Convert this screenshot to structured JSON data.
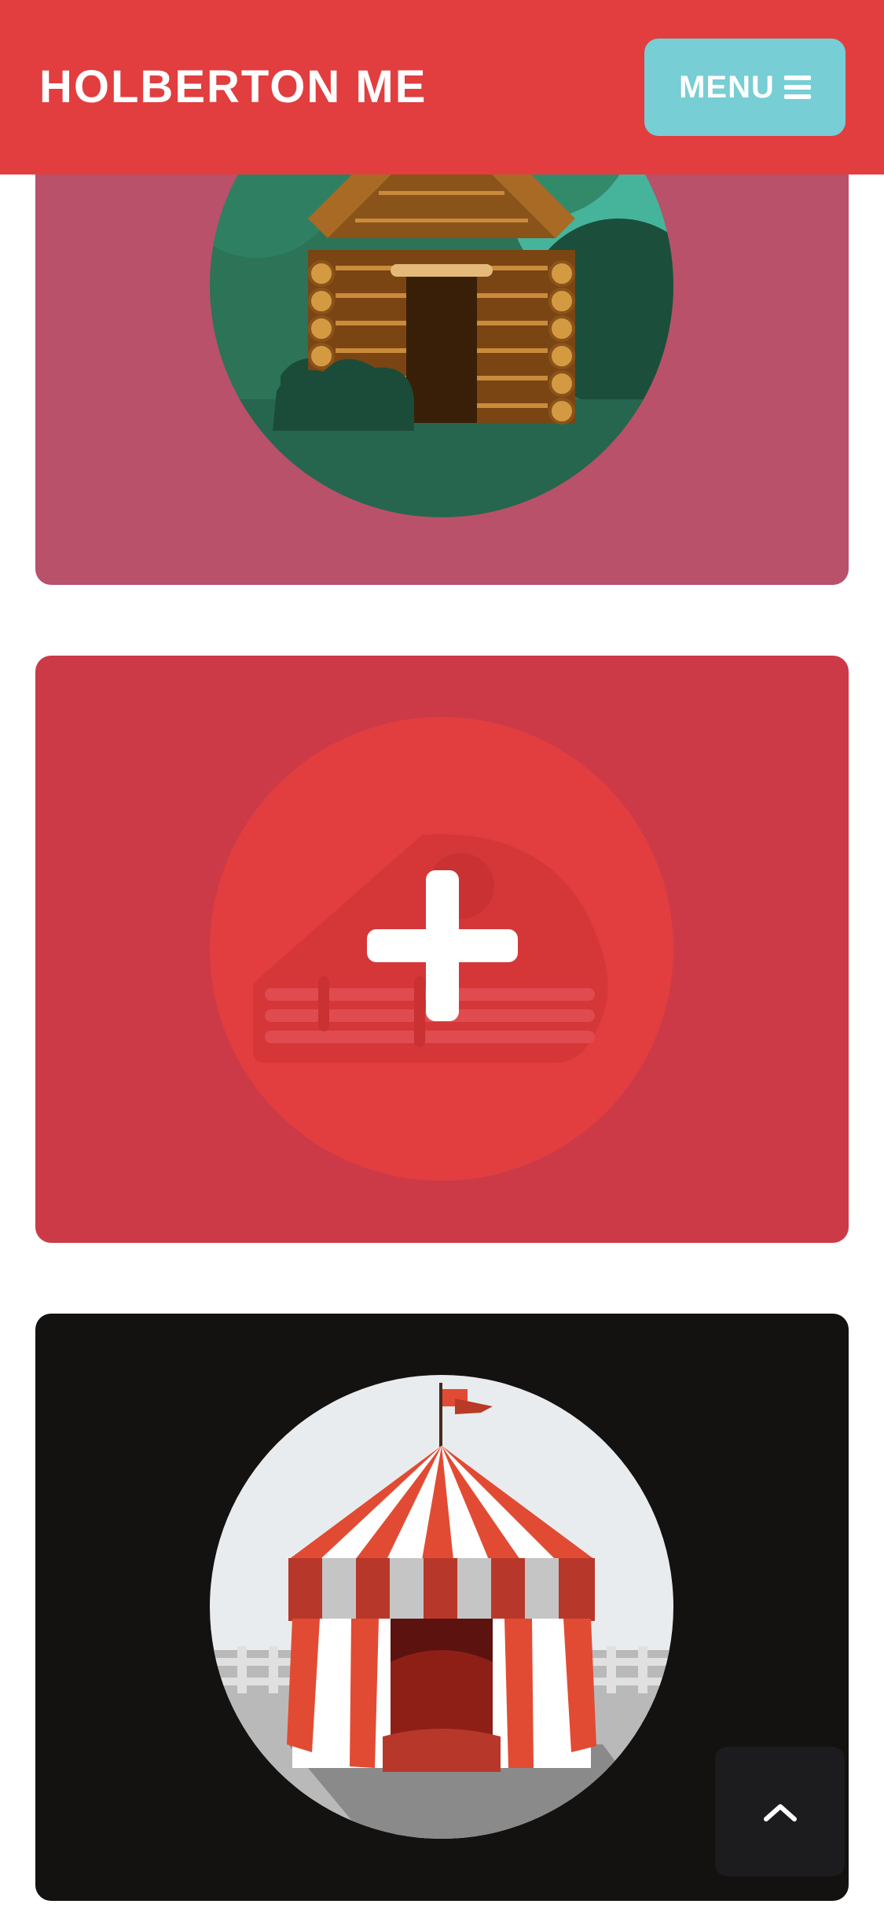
{
  "header": {
    "title": "HOLBERTON ME",
    "menu_label": "MENU",
    "menu_icon": "hamburger-icon"
  },
  "cards": [
    {
      "name": "cabin-card",
      "icon": "log-cabin-icon",
      "color": "#b85169"
    },
    {
      "name": "add-project-card",
      "icon": "plus-icon",
      "color": "#cc3a47"
    },
    {
      "name": "circus-card",
      "icon": "circus-tent-icon",
      "color": "#141111"
    }
  ],
  "back_to_top": {
    "icon": "chevron-up-icon"
  },
  "colors": {
    "header": "#e23e3f",
    "menu_button": "#77ced4",
    "back_to_top": "#1c1c1e"
  }
}
